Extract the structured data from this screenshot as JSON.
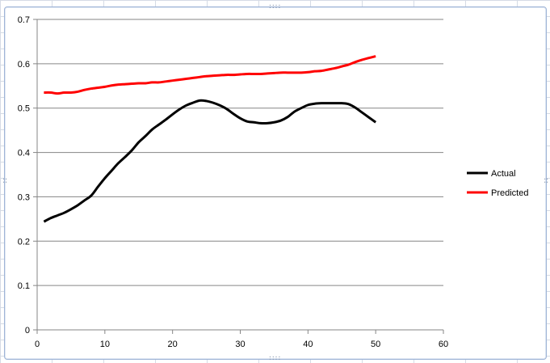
{
  "chart_data": {
    "type": "line",
    "title": "",
    "xlabel": "",
    "ylabel": "",
    "xlim": [
      0,
      60
    ],
    "ylim": [
      0,
      0.7
    ],
    "x_ticks": [
      0,
      10,
      20,
      30,
      40,
      50,
      60
    ],
    "y_ticks": [
      0,
      0.1,
      0.2,
      0.3,
      0.4,
      0.5,
      0.6,
      0.7
    ],
    "y_tick_labels": [
      "0",
      "0.1",
      "0.2",
      "0.3",
      "0.4",
      "0.5",
      "0.6",
      "0.7"
    ],
    "x_tick_labels": [
      "0",
      "10",
      "20",
      "30",
      "40",
      "50",
      "60"
    ],
    "grid": "horizontal",
    "legend_position": "right",
    "x": [
      1,
      2,
      3,
      4,
      5,
      6,
      7,
      8,
      9,
      10,
      11,
      12,
      13,
      14,
      15,
      16,
      17,
      18,
      19,
      20,
      21,
      22,
      23,
      24,
      25,
      26,
      27,
      28,
      29,
      30,
      31,
      32,
      33,
      34,
      35,
      36,
      37,
      38,
      39,
      40,
      41,
      42,
      43,
      44,
      45,
      46,
      47,
      48,
      49,
      50
    ],
    "series": [
      {
        "name": "Actual",
        "color": "#000000",
        "values": [
          0.244,
          0.252,
          0.258,
          0.264,
          0.272,
          0.281,
          0.292,
          0.303,
          0.323,
          0.342,
          0.359,
          0.376,
          0.39,
          0.405,
          0.423,
          0.437,
          0.452,
          0.463,
          0.474,
          0.486,
          0.497,
          0.506,
          0.512,
          0.517,
          0.516,
          0.512,
          0.506,
          0.498,
          0.487,
          0.477,
          0.47,
          0.468,
          0.466,
          0.466,
          0.468,
          0.472,
          0.48,
          0.492,
          0.5,
          0.507,
          0.51,
          0.511,
          0.511,
          0.511,
          0.511,
          0.509,
          0.501,
          0.49,
          0.479,
          0.468
        ]
      },
      {
        "name": "Predicted",
        "color": "#ff0000",
        "values": [
          0.535,
          0.535,
          0.533,
          0.535,
          0.535,
          0.537,
          0.541,
          0.544,
          0.546,
          0.548,
          0.551,
          0.553,
          0.554,
          0.555,
          0.556,
          0.556,
          0.558,
          0.558,
          0.56,
          0.562,
          0.564,
          0.566,
          0.568,
          0.57,
          0.572,
          0.573,
          0.574,
          0.575,
          0.575,
          0.576,
          0.577,
          0.577,
          0.577,
          0.578,
          0.579,
          0.58,
          0.58,
          0.58,
          0.58,
          0.581,
          0.583,
          0.584,
          0.587,
          0.59,
          0.594,
          0.598,
          0.604,
          0.609,
          0.613,
          0.617
        ]
      }
    ]
  }
}
